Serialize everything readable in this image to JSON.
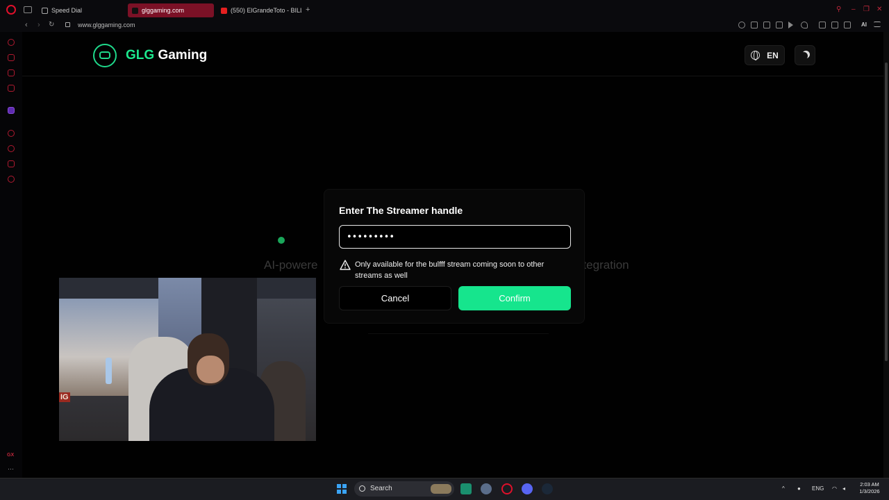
{
  "browser": {
    "tabs": [
      {
        "label": "Speed Dial",
        "active": false
      },
      {
        "label": "glggaming.com",
        "active": true
      },
      {
        "label": "(550) ElGrandeToto - BILLI",
        "active": false
      }
    ],
    "url": "www.glggaming.com",
    "ai_label": "AI"
  },
  "site": {
    "brand_accent": "GLG",
    "brand_rest": " Gaming",
    "language": "EN",
    "hero_left": "AI-powere",
    "hero_right": "ntegration"
  },
  "modal": {
    "title": "Enter The Streamer handle",
    "input_value": "•••••••••",
    "warning": "Only available for the bulfff stream coming soon to other streams as well",
    "cancel_label": "Cancel",
    "confirm_label": "Confirm"
  },
  "webcam": {
    "sign_text": "IG"
  },
  "sidebar": {
    "gx_label": "GX"
  },
  "taskbar": {
    "search_label": "Search",
    "lang": "ENG",
    "time": "2:03 AM",
    "date": "1/3/2026"
  },
  "colors": {
    "accent": "#1ce88e",
    "confirm": "#16e58d",
    "opera_red": "#e0102b"
  }
}
